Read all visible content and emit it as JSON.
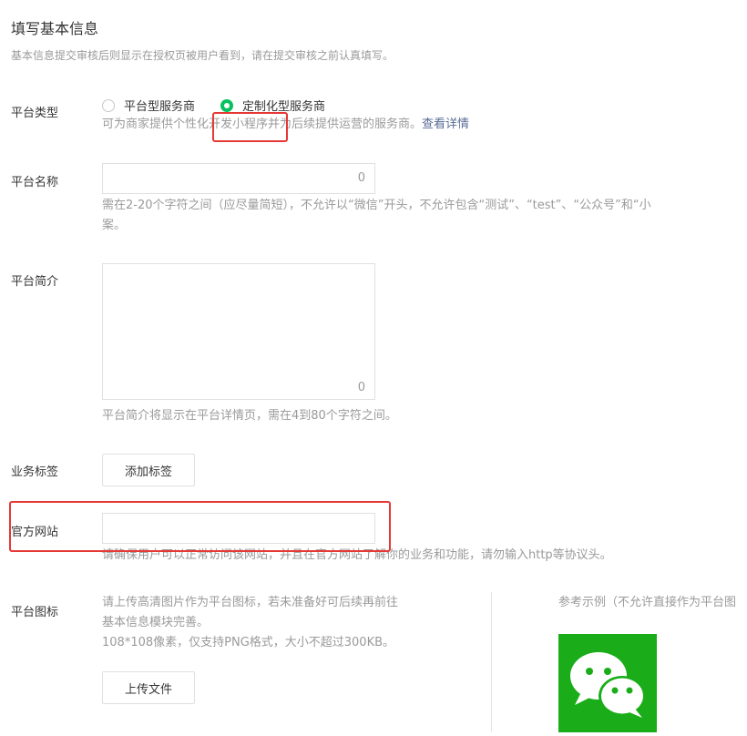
{
  "header": {
    "title": "填写基本信息",
    "subtitle": "基本信息提交审核后则显示在授权页被用户看到，请在提交审核之前认真填写。"
  },
  "platform_type": {
    "label": "平台类型",
    "options": [
      "平台型服务商",
      "定制化型服务商"
    ],
    "selected": "定制化型服务商",
    "hint_before": "可为商家提供个性化",
    "hint_highlight": "开发小程序",
    "hint_after": "并为后续提供运营的服务商。",
    "link": "查看详情"
  },
  "platform_name": {
    "label": "平台名称",
    "counter": "0",
    "hint_line1": "需在2-20个字符之间（应尽量简短），不允许以“微信”开头，不允许包含“测试”、“test”、“公众号”和“小",
    "hint_line2": "案。"
  },
  "platform_intro": {
    "label": "平台简介",
    "counter": "0",
    "hint": "平台简介将显示在平台详情页，需在4到80个字符之间。"
  },
  "business_tags": {
    "label": "业务标签",
    "button": "添加标签"
  },
  "official_site": {
    "label": "官方网站",
    "hint": "请确保用户可以正常访问该网站，并且在官方网站了解你的业务和功能，请勿输入http等协议头。"
  },
  "platform_icon": {
    "label": "平台图标",
    "desc_line1": "请上传高清图片作为平台图标，若未准备好可后续再前往",
    "desc_line2": "基本信息模块完善。",
    "desc_line3": "108*108像素，仅支持PNG格式，大小不超过300KB。",
    "button": "上传文件",
    "example_label": "参考示例（不允许直接作为平台图",
    "example_icon": "wechat-logo"
  },
  "colors": {
    "accent_green": "#07c160",
    "wechat_green": "#1aad19",
    "link_blue": "#576b95",
    "highlight_red": "#e53935"
  }
}
